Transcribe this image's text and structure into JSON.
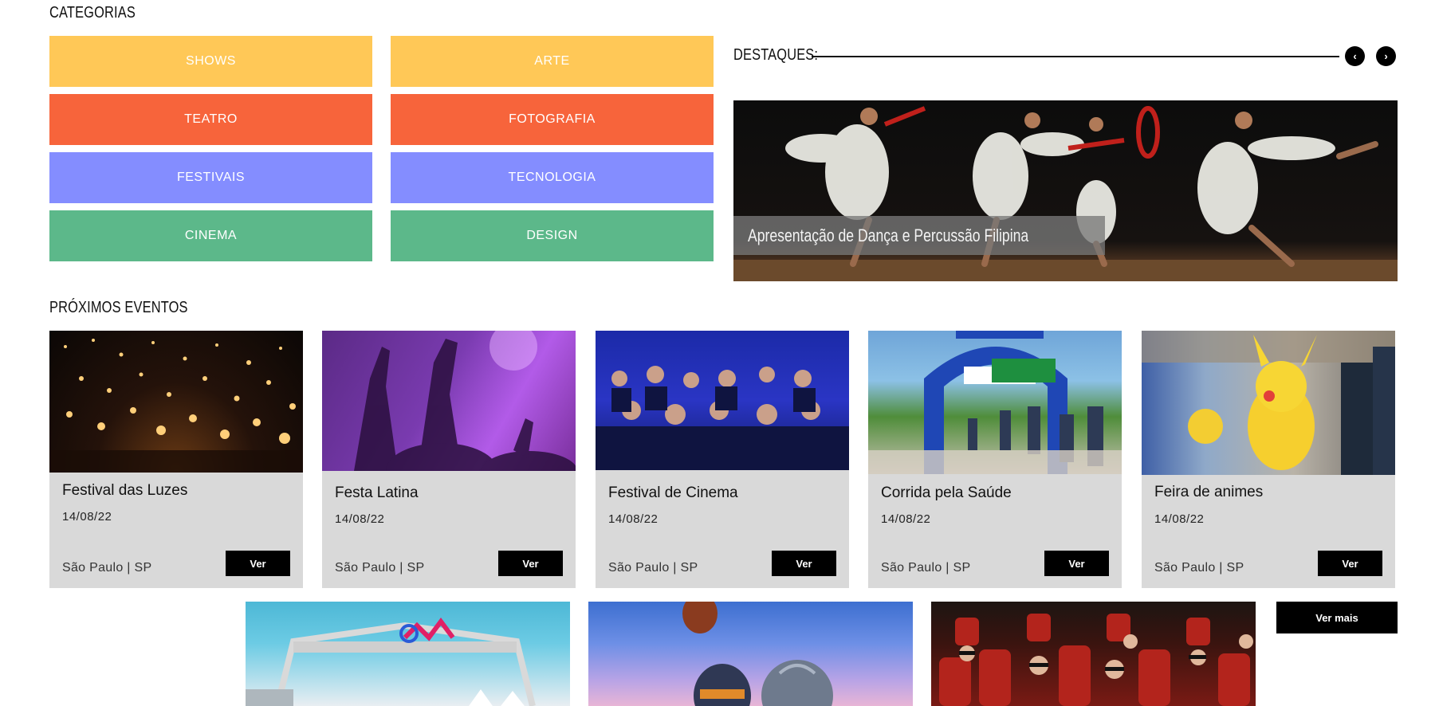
{
  "categories": {
    "title": "CATEGORIAS",
    "items": [
      {
        "label": "SHOWS",
        "color": "#FFC857"
      },
      {
        "label": "ARTE",
        "color": "#FFC857"
      },
      {
        "label": "TEATRO",
        "color": "#F7643B"
      },
      {
        "label": "FOTOGRAFIA",
        "color": "#F7643B"
      },
      {
        "label": "FESTIVAIS",
        "color": "#848DFF"
      },
      {
        "label": "TECNOLOGIA",
        "color": "#848DFF"
      },
      {
        "label": "CINEMA",
        "color": "#5CB88A"
      },
      {
        "label": "DESIGN",
        "color": "#5CB88A"
      }
    ]
  },
  "destaques": {
    "title": "DESTAQUES:",
    "prev_icon": "‹",
    "next_icon": "›",
    "caption": "Apresentação de Dança e Percussão Filipina"
  },
  "proximos": {
    "title": "PRÓXIMOS EVENTOS",
    "events": [
      {
        "title": "Festival das Luzes",
        "date": "14/08/22",
        "location": "São Paulo | SP",
        "button": "Ver"
      },
      {
        "title": "Festa Latina",
        "date": "14/08/22",
        "location": "São Paulo | SP",
        "button": "Ver"
      },
      {
        "title": "Festival de Cinema",
        "date": "14/08/22",
        "location": "São Paulo | SP",
        "button": "Ver"
      },
      {
        "title": "Corrida pela Saúde",
        "date": "14/08/22",
        "location": "São Paulo | SP",
        "button": "Ver"
      },
      {
        "title": "Feira de animes",
        "date": "14/08/22",
        "location": "São Paulo | SP",
        "button": "Ver"
      }
    ],
    "ver_mais": "Ver mais"
  },
  "colors": {
    "accent_black": "#000000",
    "card_bg": "#D9D9D9",
    "yellow": "#FFC857",
    "orange": "#F7643B",
    "blue": "#848DFF",
    "green": "#5CB88A"
  }
}
